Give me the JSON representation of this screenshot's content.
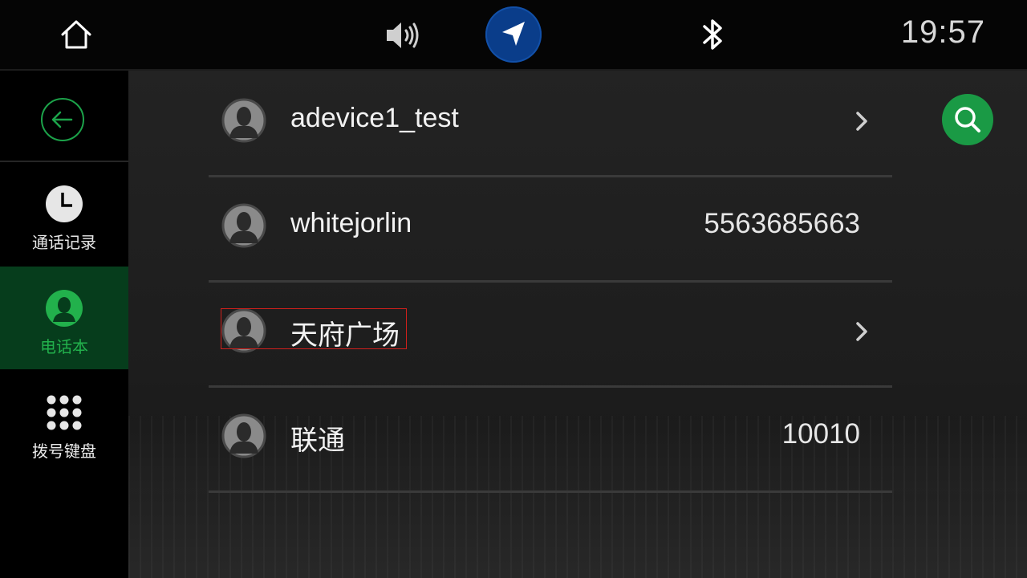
{
  "status_bar": {
    "clock": "19:57",
    "icons": [
      "home-icon",
      "volume-icon",
      "navigation-icon",
      "bluetooth-icon"
    ],
    "nav_button_color": "#0a3d8a"
  },
  "sidebar": {
    "back_icon": "back-arrow-icon",
    "items": [
      {
        "label": "通话记录",
        "icon": "clock-icon",
        "active": false
      },
      {
        "label": "电话本",
        "icon": "contact-icon",
        "active": true
      },
      {
        "label": "拨号键盘",
        "icon": "dialpad-icon",
        "active": false
      }
    ],
    "accent_color": "#22b14c"
  },
  "contacts": [
    {
      "name": "adevice1_test",
      "number": "",
      "has_chevron": true
    },
    {
      "name": "whitejorlin",
      "number": "5563685663",
      "has_chevron": false
    },
    {
      "name": "天府广场",
      "number": "",
      "has_chevron": true
    },
    {
      "name": "联通",
      "number": "10010",
      "has_chevron": false
    }
  ],
  "search_button": {
    "icon": "search-icon",
    "color": "#1a9a45"
  }
}
